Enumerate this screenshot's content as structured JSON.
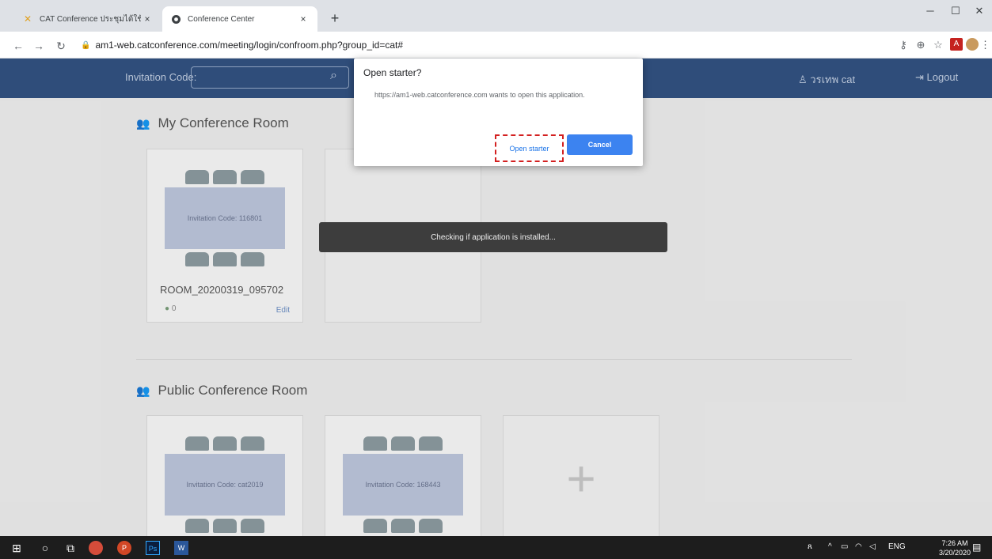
{
  "browser": {
    "tabs": [
      {
        "title": "CAT Conference ประชุมได้ใช้จัดจำกั",
        "icon": "cat-logo-icon",
        "active": false
      },
      {
        "title": "Conference Center",
        "icon": "globe-icon",
        "active": true
      }
    ],
    "url": "am1-web.catconference.com/meeting/login/confroom.php?group_id=cat#"
  },
  "header": {
    "invitation_label": "Invitation Code:",
    "user_name": "วรเทพ cat",
    "logout_label": "Logout"
  },
  "my_rooms": {
    "title": "My Conference Room",
    "rooms": [
      {
        "invitation": "Invitation Code:  116801",
        "name": "ROOM_20200319_095702",
        "participants": "0",
        "edit": "Edit"
      }
    ]
  },
  "public_rooms": {
    "title": "Public Conference Room",
    "rooms": [
      {
        "invitation": "Invitation Code:  cat2019"
      },
      {
        "invitation": "Invitation Code:  168443"
      }
    ]
  },
  "toast": "Checking if application is installed...",
  "dialog": {
    "title": "Open starter?",
    "message": "https://am1-web.catconference.com wants to open this application.",
    "open_label": "Open starter",
    "cancel_label": "Cancel"
  },
  "taskbar": {
    "lang": "ENG",
    "time": "7:26 AM",
    "date": "3/20/2020"
  }
}
